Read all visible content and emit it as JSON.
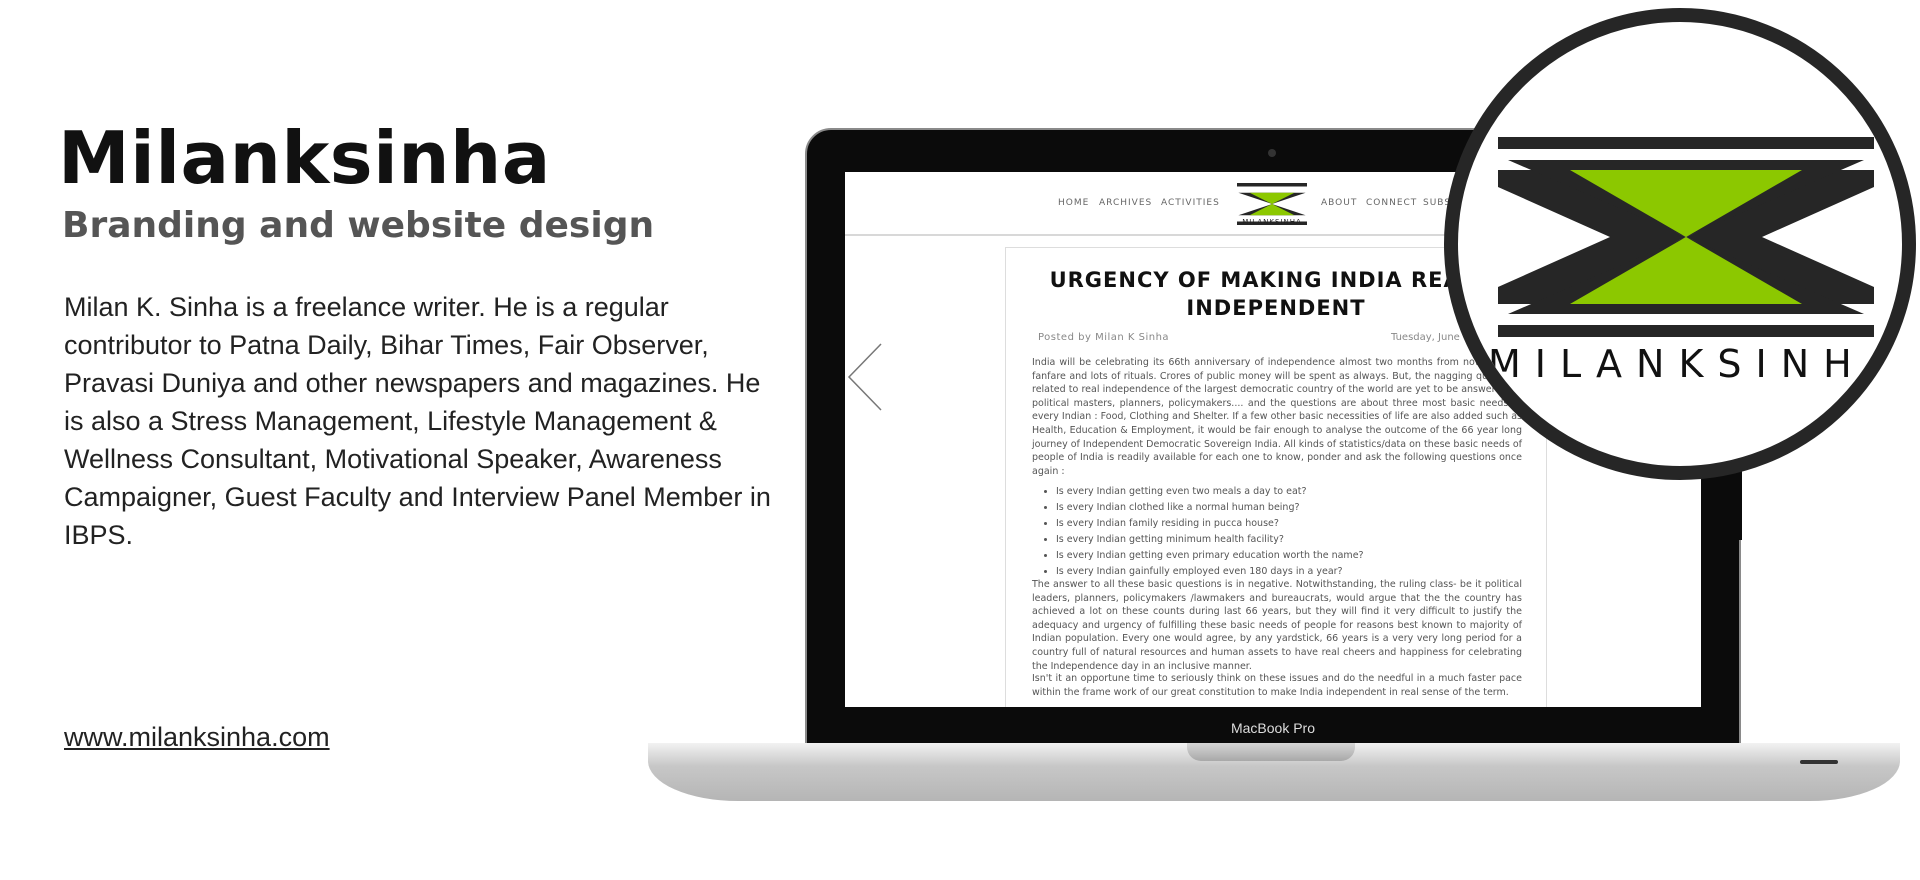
{
  "heading": {
    "title": "Milanksinha",
    "subtitle": "Branding and website design"
  },
  "bio": "Milan K. Sinha is a freelance writer. He is a regular contributor to Patna Daily, Bihar Times, Fair Observer, Pravasi Duniya and other newspapers and magazines. He is also a Stress Management, Lifestyle Management & Wellness Consultant, Motivational Speaker, Awareness Campaigner, Guest Faculty and Interview Panel Member in IBPS.",
  "website": "www.milanksinha.com",
  "laptop": {
    "model": "MacBook Pro"
  },
  "site": {
    "nav": {
      "home": "HOME",
      "archives": "ARCHIVES",
      "activities": "ACTIVITIES",
      "about": "ABOUT",
      "connect": "CONNECT",
      "subscribe": "SUBS"
    },
    "logo_text": "MILANKSINHA",
    "article": {
      "title": "URGENCY OF MAKING INDIA REALLY INDEPENDENT",
      "posted_prefix": "Posted by",
      "author": "Milan K Sinha",
      "date": "Tuesday, June",
      "para1": "India will be celebrating its 66th anniversary of independence almost two months from now with all fanfare and lots of rituals. Crores of public money will be spent as always. But, the nagging questions related to real independence of the largest democratic country of the world are yet to be answered by political masters, planners, policymakers.... and the questions are about three most basic needs of every Indian : Food, Clothing and Shelter. If a few other basic necessities of life are also added such as Health, Education & Employment, it would be fair enough to analyse the outcome of the 66 year long journey of Independent Democratic Sovereign India. All kinds of statistics/data on these basic needs of people of India is readily available for each one to know, ponder and ask the following questions once again :",
      "questions": [
        "Is every Indian getting even two meals a day to eat?",
        "Is every Indian clothed like a normal human being?",
        "Is every Indian family residing in pucca house?",
        "Is every Indian getting minimum health facility?",
        "Is every Indian getting even primary education worth the name?",
        "Is every Indian gainfully employed even 180 days in a year?"
      ],
      "para2": "The answer to all these basic questions is in negative. Notwithstanding, the ruling class- be it political leaders, planners, policymakers /lawmakers and bureaucrats, would argue that the the country has achieved a lot on these counts during last 66 years, but they will find it very difficult to justify the adequacy and urgency of fulfilling these basic needs of people for reasons best known to majority of Indian population. Every one would agree, by any yardstick, 66 years is a very very long period for a country full of natural resources and human assets to have real cheers and happiness for celebrating the Independence day in an inclusive manner.",
      "para3": "Isn't it an opportune time to seriously think on these issues and do the needful in a much faster pace within the frame work of our great constitution to make India independent in real sense of the term."
    }
  },
  "magnifier": {
    "logo_text": "MILANKSINHA"
  },
  "colors": {
    "logo_green": "#8cc800",
    "logo_dark": "#262626"
  }
}
